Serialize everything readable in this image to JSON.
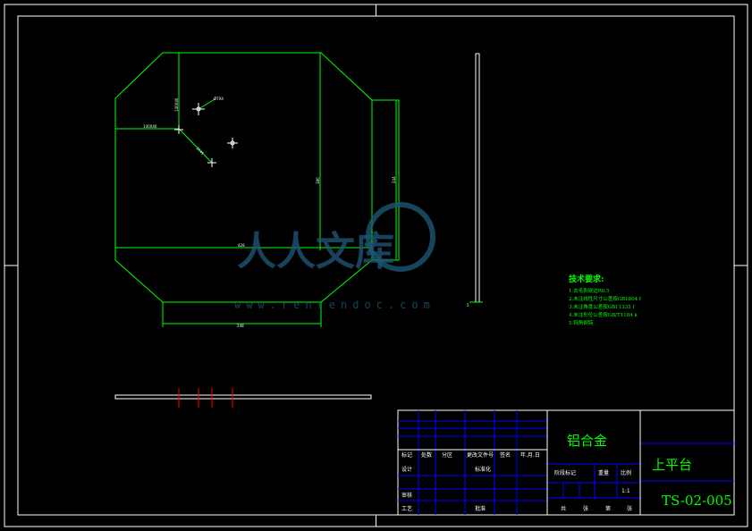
{
  "dimensions": {
    "d1": "Ø7X4",
    "d2": "140X40",
    "d3": "140X40",
    "d4": "2X45",
    "d5": "380",
    "d6": "428",
    "d7": "244",
    "d8": "248"
  },
  "technical_requirements": {
    "title": "技术要求:",
    "items": [
      "1.去毛刺锐边R0.5",
      "2.未注线性尺寸公差按GB1804 f",
      "3.未注角度公差按GB11335 f",
      "4.未注形位公差按GB/T1184 k",
      "5.钝角倒钝"
    ]
  },
  "title_block": {
    "material": "铝合金",
    "part_name": "上平台",
    "drawing_number": "TS-02-005",
    "scale_value": "1:1",
    "revision_labels": [
      "标记",
      "处数",
      "分区",
      "更改文件号",
      "签名",
      "年.月.日"
    ],
    "design_label": "设计",
    "standardize_label": "标准化",
    "review_label": "审核",
    "process_label": "工艺",
    "approve_label": "批准",
    "stage_header": "阶段标记",
    "weight_header": "重量",
    "scale_header": "比例",
    "sheet_labels": [
      "共",
      "张",
      "第",
      "张"
    ]
  },
  "colors": {
    "border": "#ffffff",
    "outline": "#00ff00",
    "grid": "#0000ff",
    "cutline": "#ff0000",
    "watermark": "#1d5673"
  },
  "watermark": {
    "text": "人人文库",
    "url": "www.renrendoc.com"
  }
}
